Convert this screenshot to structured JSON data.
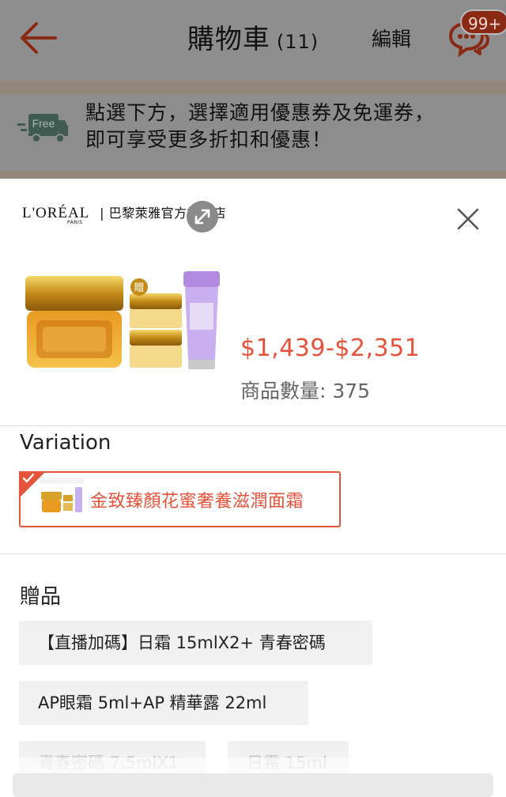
{
  "header": {
    "title": "購物車",
    "count": "(11)",
    "edit_label": "編輯",
    "chat_badge": "99+"
  },
  "banner": {
    "free_label": "Free",
    "line1": "點選下方，選擇適用優惠券及免運券，",
    "line2": "即可享受更多折扣和優惠！"
  },
  "sheet": {
    "shop_brand": "L'ORÉAL",
    "shop_brand_sub": "PARIS",
    "shop_name": "巴黎萊雅官方旗艦店",
    "gift_tag": "贈",
    "price": "$1,439-$2,351",
    "stock": "商品數量: 375",
    "variation_title": "Variation",
    "variation_option": "金致臻顏花蜜奢養滋潤面霜",
    "gift_title": "贈品",
    "gifts": [
      "【直播加碼】日霜 15mlX2+ 青春密碼",
      "AP眼霜 5ml+AP 精華露 22ml",
      "青春密碼 7.5mlX1",
      "日霜 15ml"
    ]
  },
  "colors": {
    "accent": "#e4533a",
    "overlay": "#8e8e8e",
    "chip_bg": "#f1f1f1"
  },
  "icons": {
    "back": "back-arrow-icon",
    "chat": "chat-bubbles-icon",
    "truck": "free-shipping-truck-icon",
    "expand": "expand-icon",
    "close": "close-icon",
    "check": "check-icon"
  }
}
